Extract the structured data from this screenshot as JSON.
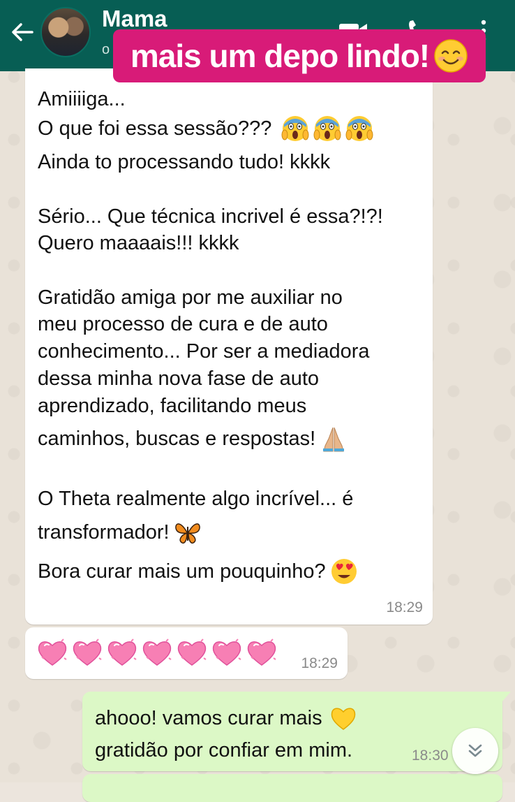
{
  "header": {
    "contact_name": "Mama",
    "status": "o",
    "icons": [
      "back-arrow-icon",
      "avatar",
      "video-call-icon",
      "voice-call-icon",
      "more-options-icon"
    ],
    "background_color": "#075E54"
  },
  "banner": {
    "text": "mais um depo lindo!",
    "emoji": "smiling-face-icon",
    "background_color": "#D81B78"
  },
  "messages": [
    {
      "direction": "incoming",
      "lines": [
        "Amiiiiga...",
        "O que foi essa sessão???",
        "Ainda to processando tudo! kkkk",
        "Sério... Que técnica incrivel é essa?!?!",
        "Quero maaaais!!! kkkk",
        "Gratidão amiga por me auxiliar no",
        "meu processo de cura e de auto",
        "conhecimento... Por ser a  mediadora",
        "dessa minha nova fase de auto",
        "aprendizado, facilitando meus",
        "caminhos, buscas e respostas!",
        "O Theta realmente algo incrível... é",
        "transformador!",
        "Bora curar mais um pouquinho?"
      ],
      "emojis": [
        "scream-icon",
        "scream-icon",
        "scream-icon",
        "folded-hands-icon",
        "butterfly-icon",
        "heart-eyes-icon"
      ],
      "time": "18:29"
    },
    {
      "direction": "incoming",
      "emojis": [
        "sparkling-heart-icon",
        "sparkling-heart-icon",
        "sparkling-heart-icon",
        "sparkling-heart-icon",
        "sparkling-heart-icon",
        "sparkling-heart-icon",
        "sparkling-heart-icon"
      ],
      "time": "18:29"
    },
    {
      "direction": "outgoing",
      "lines": [
        "ahooo! vamos curar mais",
        "gratidão por confiar em mim."
      ],
      "emojis": [
        "yellow-heart-icon"
      ],
      "time": "18:30"
    }
  ],
  "scroll_button": {
    "icon": "double-chevron-down-icon"
  },
  "colors": {
    "incoming_bubble": "#FFFFFF",
    "outgoing_bubble": "#DCF8C6",
    "wallpaper": "#E9E2D8"
  }
}
